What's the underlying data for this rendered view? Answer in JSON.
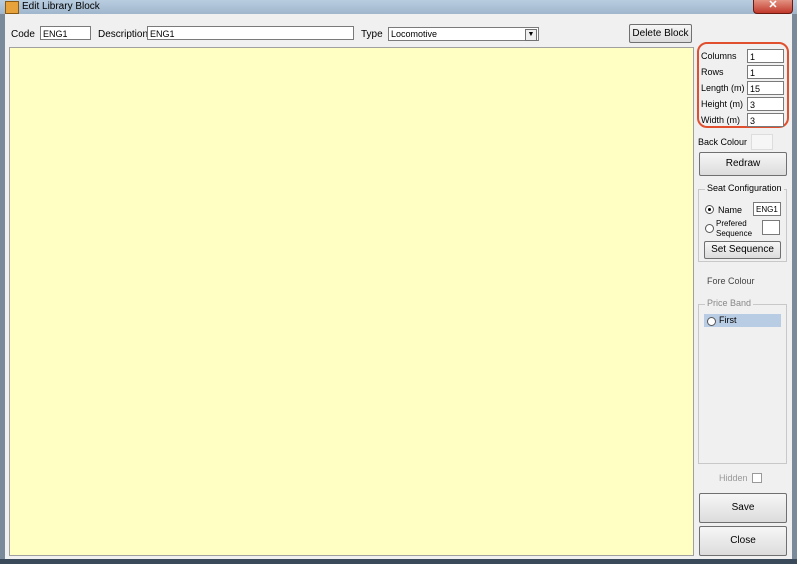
{
  "window": {
    "title": "Edit Library Block",
    "close": "✕"
  },
  "toolbar": {
    "code_label": "Code",
    "code_value": "ENG1",
    "description_label": "Description",
    "description_value": "ENG1",
    "type_label": "Type",
    "type_value": "Locomotive",
    "delete_label": "Delete Block"
  },
  "dims": {
    "columns_label": "Columns",
    "columns_value": "1",
    "rows_label": "Rows",
    "rows_value": "1",
    "length_label": "Length (m)",
    "length_value": "15",
    "height_label": "Height (m)",
    "height_value": "3",
    "width_label": "Width (m)",
    "width_value": "3"
  },
  "back_colour_label": "Back Colour",
  "redraw_label": "Redraw",
  "seat_config": {
    "title": "Seat Configuration",
    "name_label": "Name",
    "name_value": "ENG1",
    "preferred_label_line1": "Prefered",
    "preferred_label_line2": "Sequence",
    "preferred_value": "",
    "set_sequence_label": "Set Sequence",
    "selected": "name"
  },
  "fore_colour_label": "Fore Colour",
  "price_band": {
    "title": "Price Band",
    "items": [
      "First"
    ]
  },
  "hidden_label": "Hidden",
  "save_label": "Save",
  "close_label": "Close"
}
